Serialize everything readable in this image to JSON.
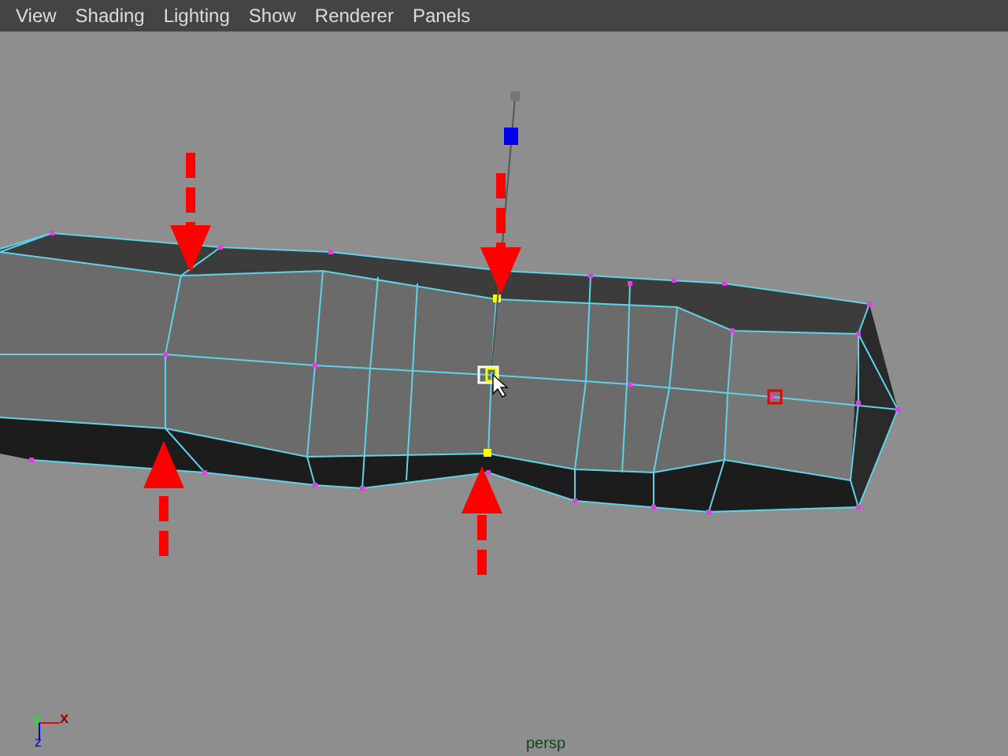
{
  "menu": [
    {
      "label": "View"
    },
    {
      "label": "Shading"
    },
    {
      "label": "Lighting"
    },
    {
      "label": "Show"
    },
    {
      "label": "Renderer"
    },
    {
      "label": "Panels"
    }
  ],
  "axes": {
    "y": "y",
    "x": "x",
    "z": "z"
  },
  "camera": "persp"
}
